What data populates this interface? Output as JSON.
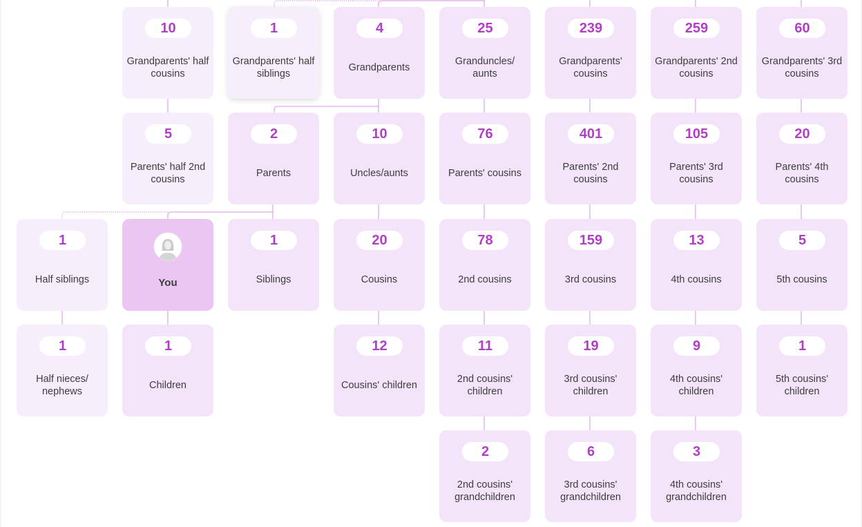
{
  "colors": {
    "accent": "#b03fc6",
    "card": "#f4e4fa",
    "card_half": "#f7eefb",
    "card_you": "#ebc6f3",
    "connector": "#e4b6ee",
    "text": "#3d3d3d"
  },
  "you": {
    "label": "You",
    "avatar": "user-avatar-icon"
  },
  "cards": [
    {
      "id": "grandparents-half-cousins",
      "count": "10",
      "label": "Grandparents' half cousins",
      "half": true
    },
    {
      "id": "grandparents-half-siblings",
      "count": "1",
      "label": "Grandparents' half siblings",
      "half": true,
      "hovered": true
    },
    {
      "id": "grandparents",
      "count": "4",
      "label": "Grandparents"
    },
    {
      "id": "granduncles-aunts",
      "count": "25",
      "label": "Granduncles/ aunts"
    },
    {
      "id": "grandparents-cousins",
      "count": "239",
      "label": "Grandparents' cousins"
    },
    {
      "id": "grandparents-2nd-cousins",
      "count": "259",
      "label": "Grandparents' 2nd cousins"
    },
    {
      "id": "grandparents-3rd-cousins",
      "count": "60",
      "label": "Grandparents' 3rd cousins"
    },
    {
      "id": "parents-half-2nd-cousins",
      "count": "5",
      "label": "Parents' half 2nd cousins",
      "half": true
    },
    {
      "id": "parents",
      "count": "2",
      "label": "Parents"
    },
    {
      "id": "uncles-aunts",
      "count": "10",
      "label": "Uncles/aunts"
    },
    {
      "id": "parents-cousins",
      "count": "76",
      "label": "Parents' cousins"
    },
    {
      "id": "parents-2nd-cousins",
      "count": "401",
      "label": "Parents' 2nd cousins"
    },
    {
      "id": "parents-3rd-cousins",
      "count": "105",
      "label": "Parents' 3rd cousins"
    },
    {
      "id": "parents-4th-cousins",
      "count": "20",
      "label": "Parents' 4th cousins"
    },
    {
      "id": "half-siblings",
      "count": "1",
      "label": "Half siblings",
      "half": true
    },
    {
      "id": "siblings",
      "count": "1",
      "label": "Siblings"
    },
    {
      "id": "cousins",
      "count": "20",
      "label": "Cousins"
    },
    {
      "id": "2nd-cousins",
      "count": "78",
      "label": "2nd cousins"
    },
    {
      "id": "3rd-cousins",
      "count": "159",
      "label": "3rd cousins"
    },
    {
      "id": "4th-cousins",
      "count": "13",
      "label": "4th cousins"
    },
    {
      "id": "5th-cousins",
      "count": "5",
      "label": "5th cousins"
    },
    {
      "id": "half-nieces-nephews",
      "count": "1",
      "label": "Half nieces/ nephews",
      "half": true
    },
    {
      "id": "children",
      "count": "1",
      "label": "Children"
    },
    {
      "id": "cousins-children",
      "count": "12",
      "label": "Cousins' children"
    },
    {
      "id": "2nd-cousins-children",
      "count": "11",
      "label": "2nd cousins' children"
    },
    {
      "id": "3rd-cousins-children",
      "count": "19",
      "label": "3rd cousins' children"
    },
    {
      "id": "4th-cousins-children",
      "count": "9",
      "label": "4th cousins' children"
    },
    {
      "id": "5th-cousins-children",
      "count": "1",
      "label": "5th cousins' children"
    },
    {
      "id": "2nd-cousins-grandchildren",
      "count": "2",
      "label": "2nd cousins' grandchildren"
    },
    {
      "id": "3rd-cousins-grandchildren",
      "count": "6",
      "label": "3rd cousins' grandchildren"
    },
    {
      "id": "4th-cousins-grandchildren",
      "count": "3",
      "label": "4th cousins' grandchildren"
    }
  ]
}
